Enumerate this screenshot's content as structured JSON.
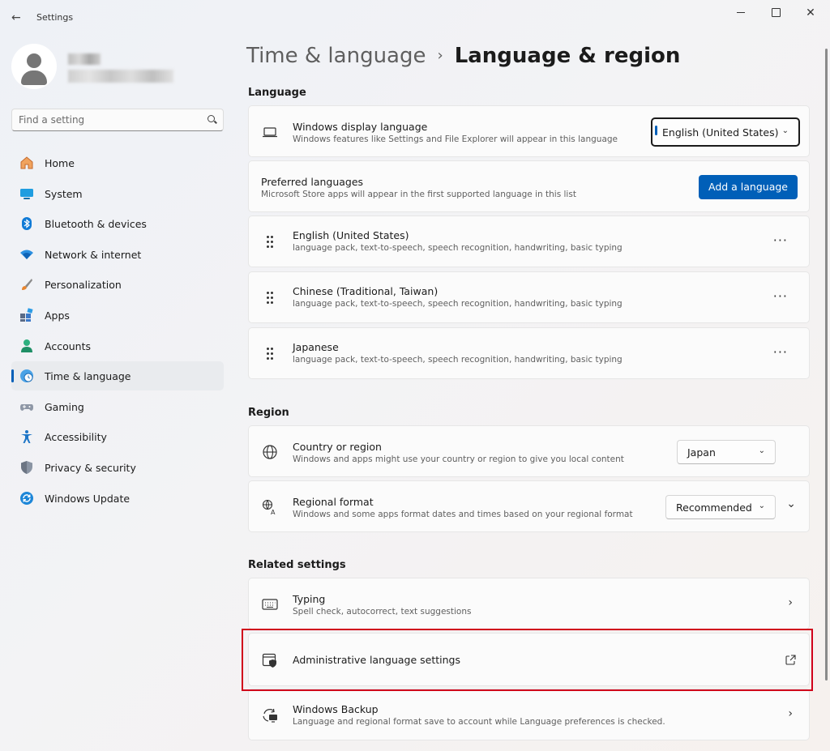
{
  "window": {
    "title": "Settings",
    "back_icon": "←",
    "minimize_icon": "minimize-icon",
    "maximize_icon": "maximize-icon",
    "close_icon": "✕"
  },
  "search": {
    "placeholder": "Find a setting"
  },
  "sidebar": {
    "items": [
      {
        "label": "Home",
        "icon": "home-icon",
        "active": false
      },
      {
        "label": "System",
        "icon": "system-icon",
        "active": false
      },
      {
        "label": "Bluetooth & devices",
        "icon": "bluetooth-icon",
        "active": false
      },
      {
        "label": "Network & internet",
        "icon": "wifi-icon",
        "active": false
      },
      {
        "label": "Personalization",
        "icon": "brush-icon",
        "active": false
      },
      {
        "label": "Apps",
        "icon": "apps-icon",
        "active": false
      },
      {
        "label": "Accounts",
        "icon": "accounts-icon",
        "active": false
      },
      {
        "label": "Time & language",
        "icon": "clock-globe-icon",
        "active": true
      },
      {
        "label": "Gaming",
        "icon": "gamepad-icon",
        "active": false
      },
      {
        "label": "Accessibility",
        "icon": "accessibility-icon",
        "active": false
      },
      {
        "label": "Privacy & security",
        "icon": "shield-icon",
        "active": false
      },
      {
        "label": "Windows Update",
        "icon": "update-icon",
        "active": false
      }
    ]
  },
  "breadcrumb": {
    "parent": "Time & language",
    "separator": "›",
    "current": "Language & region"
  },
  "language": {
    "heading": "Language",
    "display_language": {
      "title": "Windows display language",
      "desc": "Windows features like Settings and File Explorer will appear in this language",
      "value": "English (United States)"
    },
    "preferred": {
      "title": "Preferred languages",
      "desc": "Microsoft Store apps will appear in the first supported language in this list",
      "button": "Add a language"
    },
    "languages": [
      {
        "name": "English (United States)",
        "features": "language pack, text-to-speech, speech recognition, handwriting, basic typing"
      },
      {
        "name": "Chinese (Traditional, Taiwan)",
        "features": "language pack, text-to-speech, speech recognition, handwriting, basic typing"
      },
      {
        "name": "Japanese",
        "features": "language pack, text-to-speech, speech recognition, handwriting, basic typing"
      }
    ],
    "more_label": "···"
  },
  "region": {
    "heading": "Region",
    "country": {
      "title": "Country or region",
      "desc": "Windows and apps might use your country or region to give you local content",
      "value": "Japan"
    },
    "format": {
      "title": "Regional format",
      "desc": "Windows and some apps format dates and times based on your regional format",
      "value": "Recommended"
    }
  },
  "related": {
    "heading": "Related settings",
    "typing": {
      "title": "Typing",
      "desc": "Spell check, autocorrect, text suggestions"
    },
    "admin": {
      "title": "Administrative language settings"
    },
    "backup": {
      "title": "Windows Backup",
      "desc": "Language and regional format save to account while Language preferences is checked."
    }
  },
  "colors": {
    "accent": "#005fb8",
    "highlight_box": "#d0021b"
  }
}
